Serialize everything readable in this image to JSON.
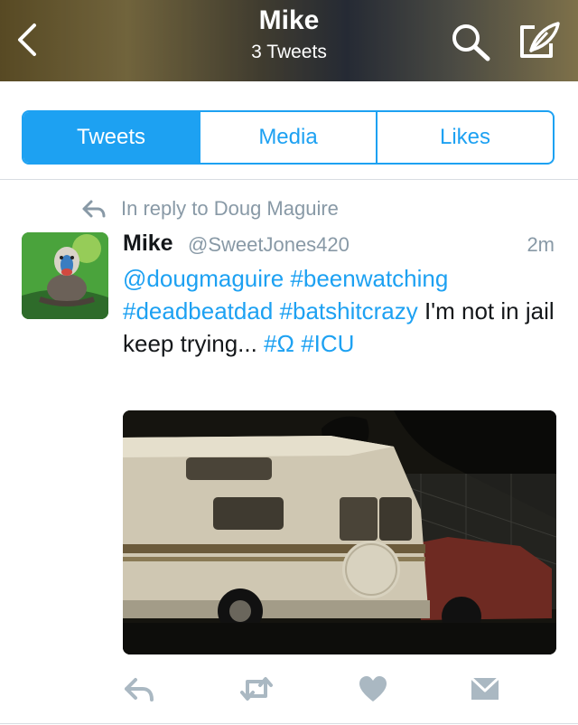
{
  "header": {
    "title": "Mike",
    "subtitle": "3 Tweets"
  },
  "tabs": [
    {
      "label": "Tweets",
      "active": true
    },
    {
      "label": "Media",
      "active": false
    },
    {
      "label": "Likes",
      "active": false
    }
  ],
  "tweet": {
    "reply_context": "In reply to Doug Maguire",
    "author_name": "Mike",
    "author_handle": "@SweetJones420",
    "time": "2m",
    "segments": [
      {
        "text": "@dougmaguire",
        "tag": true
      },
      {
        "text": " ",
        "tag": false
      },
      {
        "text": "#beenwatching",
        "tag": true
      },
      {
        "text": " ",
        "tag": false
      },
      {
        "text": "#deadbeatdad",
        "tag": true
      },
      {
        "text": " ",
        "tag": false
      },
      {
        "text": "#batshitcrazy",
        "tag": true
      },
      {
        "text": " I'm not in jail keep trying... ",
        "tag": false
      },
      {
        "text": "#Ω",
        "tag": true
      },
      {
        "text": " ",
        "tag": false
      },
      {
        "text": "#ICU",
        "tag": true
      }
    ]
  },
  "icons": {
    "back": "chevron-left-icon",
    "search": "search-icon",
    "compose": "compose-icon",
    "reply_context": "reply-icon",
    "actions": [
      "reply-icon",
      "retweet-icon",
      "like-icon",
      "direct-message-icon"
    ]
  },
  "colors": {
    "accent": "#1da1f2",
    "muted": "#8899a6",
    "text": "#14171a",
    "action_icon": "#aab8c2"
  }
}
